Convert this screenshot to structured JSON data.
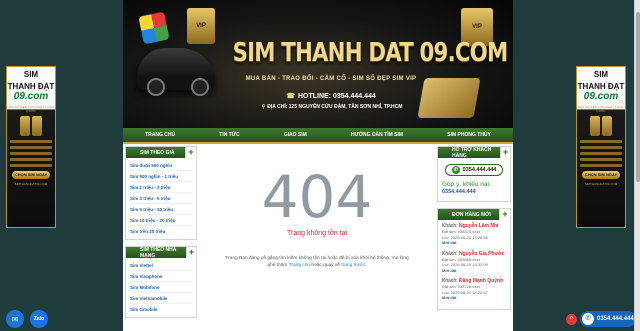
{
  "header": {
    "site_title": "SIM THANH DAT 09.COM",
    "slogan": "MUA BÁN - TRAO ĐỔI - CẦM CỐ - SIM SỐ ĐẸP SIM VIP",
    "hotline": "HOTLINE: 0354.444.444",
    "address": "ĐỊA CHỈ: 125 NGUYỄN CỬU ĐÀM, TÂN SƠN NHÌ, TP.HCM"
  },
  "nav": [
    "TRANG CHỦ",
    "TIN TỨC",
    "GIAO SIM",
    "HƯỚNG DẪN TÌM SIM",
    "SIM PHONG THỦY"
  ],
  "left": {
    "price_box": {
      "title": "SIM THEO GIÁ",
      "items": [
        "Sim dưới 500 nghìn",
        "Sim 500 nghìn - 1 triệu",
        "Sim 1 triệu - 3 triệu",
        "Sim 3 triệu - 5 triệu",
        "Sim 5 triệu - 10 triệu",
        "Sim 10 triệu - 20 triệu",
        "Sim trên 20 triệu"
      ]
    },
    "carrier_box": {
      "title": "SIM THEO NHÀ MẠNG",
      "items": [
        "Sim Viettel",
        "Sim Vinaphone",
        "Sim Mobifone",
        "Sim Vietnamobile",
        "Sim Gmobile"
      ]
    }
  },
  "center": {
    "code": "404",
    "title": "Trang không tồn tại",
    "message_before": "Trang Bạn đang cố gắng tìm kiếm không tồn tại hoặc đã bị xóa khỏi hệ thống. Vui lòng ghé thăm",
    "link1": "Trang chủ",
    "message_middle": "hoặc quay về",
    "link2": "trang trước",
    "message_after": "."
  },
  "right": {
    "support_box": {
      "title": "HỖ TRỢ KHÁCH HÀNG",
      "hotline": "0354.444.444",
      "feedback_label": "Góp ý, khiếu nại:",
      "feedback_number": "0354.444.444"
    },
    "orders_box": {
      "title": "ĐƠN HÀNG MỚI",
      "customer_label": "Khách:",
      "orders": [
        {
          "name": "Nguyễn Lâm Nhi",
          "sim": "Đặt sim: 038374.xxxx",
          "time": "Lúc: 2026-06-20 14:26:56",
          "status": "Mới đặt"
        },
        {
          "name": "Nguyễn Gia Phước",
          "sim": "Đặt sim: 033569.xxxx",
          "time": "Lúc: 2026-06-20 14:32:09",
          "status": "Mới đặt"
        },
        {
          "name": "Đặng Mạnh Quỳnh",
          "sim": "Đặt sim: 033728.xxxx",
          "time": "Lúc: 2026-06-20 14:22:47",
          "status": "Mới đặt"
        }
      ]
    }
  },
  "side_banner": {
    "title_line1": "SIM",
    "title_line2": "THANH ĐẠT",
    "title_line3": "09.com",
    "tagline": "SIM SỐ ĐẸP LỚN NHẤT TOÀN QUỐC",
    "cta": "CHỌN SIM NGAY",
    "footer": "SIMTHANHDAT09.COM"
  },
  "floating": {
    "zalo_label": "Zalo",
    "call_number": "0354.444.444"
  },
  "colors": {
    "nav_green": "#2f6a1f",
    "gold": "#f0d78a",
    "error_red": "#d32f2f",
    "page_bg": "#1f3b3c"
  }
}
